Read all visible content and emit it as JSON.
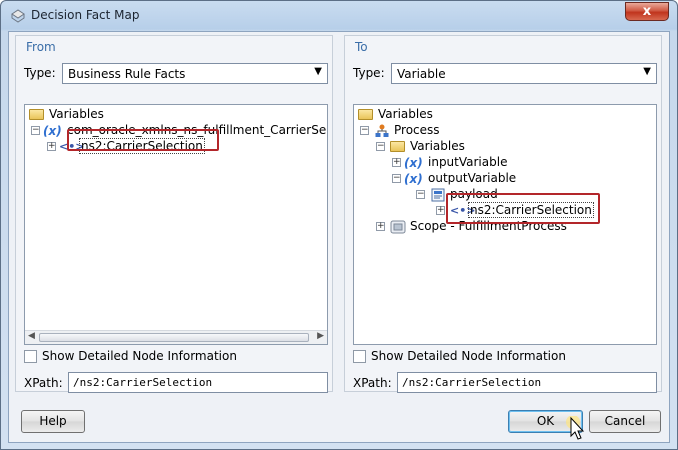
{
  "window": {
    "title": "Decision Fact Map",
    "close_glyph": "x"
  },
  "from": {
    "legend": "From",
    "type_label": "Type:",
    "type_value": "Business Rule Facts",
    "tree": [
      {
        "label": "Variables",
        "icon": "folder-icon"
      },
      {
        "label": "com_oracle_xmlns_ns_fulfillment_CarrierSelection",
        "icon": "xml-variable-icon",
        "expander": "−"
      },
      {
        "label": "ns2:CarrierSelection",
        "icon": "xml-element-icon",
        "expander": "+"
      }
    ],
    "detail_label": "Show Detailed Node Information",
    "xpath_label": "XPath:",
    "xpath_value": "/ns2:CarrierSelection"
  },
  "to": {
    "legend": "To",
    "type_label": "Type:",
    "type_value": "Variable",
    "tree": [
      {
        "label": "Variables",
        "icon": "folder-icon"
      },
      {
        "label": "Process",
        "icon": "process-icon",
        "expander": "−"
      },
      {
        "label": "Variables",
        "icon": "folder-icon",
        "expander": "−"
      },
      {
        "label": "inputVariable",
        "icon": "xml-variable-icon",
        "expander": "+"
      },
      {
        "label": "outputVariable",
        "icon": "xml-variable-icon",
        "expander": "−"
      },
      {
        "label": "payload",
        "icon": "message-part-icon",
        "expander": "−"
      },
      {
        "label": "ns2:CarrierSelection",
        "icon": "xml-element-icon",
        "expander": "+"
      },
      {
        "label": "Scope - FulfillmentProcess",
        "icon": "scope-icon",
        "expander": "+"
      }
    ],
    "detail_label": "Show Detailed Node Information",
    "xpath_label": "XPath:",
    "xpath_value": "/ns2:CarrierSelection"
  },
  "buttons": {
    "help": "Help",
    "ok": "OK",
    "cancel": "Cancel"
  },
  "colors": {
    "highlight": "#b3262a",
    "legend": "#3b6ea8",
    "variable_icon": "#2f6fd0"
  }
}
